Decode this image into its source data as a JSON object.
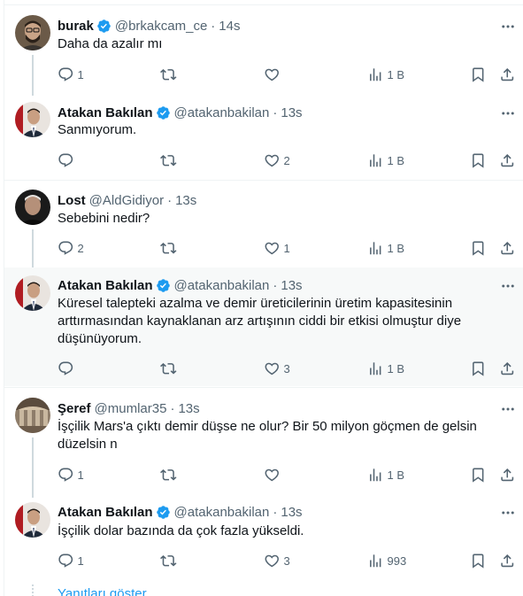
{
  "colors": {
    "verified": "#1d9bf0",
    "link": "#1d9bf0",
    "muted": "#536471",
    "highlight_bg": "#f7f9f9"
  },
  "tweets": [
    {
      "name": "burak",
      "handle": "@brkakcam_ce",
      "dot": "·",
      "time": "14s",
      "verified": true,
      "text": "Daha da azalır mı",
      "replies": "1",
      "retweets": "",
      "likes": "",
      "views": "1 B"
    },
    {
      "name": "Atakan Bakılan",
      "handle": "@atakanbakilan",
      "dot": "·",
      "time": "13s",
      "verified": true,
      "text": "Sanmıyorum.",
      "replies": "",
      "retweets": "",
      "likes": "2",
      "views": "1 B"
    },
    {
      "name": "Lost",
      "handle": "@AldGidiyor",
      "dot": "·",
      "time": "13s",
      "verified": false,
      "text": "Sebebini nedir?",
      "replies": "2",
      "retweets": "",
      "likes": "1",
      "views": "1 B"
    },
    {
      "name": "Atakan Bakılan",
      "handle": "@atakanbakilan",
      "dot": "·",
      "time": "13s",
      "verified": true,
      "text": "Küresel talepteki azalma ve demir üreticilerinin üretim kapasitesinin arttırmasından kaynaklanan arz artışının ciddi bir etkisi olmuştur diye düşünüyorum.",
      "replies": "",
      "retweets": "",
      "likes": "3",
      "views": "1 B"
    },
    {
      "name": "Şeref",
      "handle": "@mumlar35",
      "dot": "·",
      "time": "13s",
      "verified": false,
      "text": "İşçilik Mars'a çıktı demir düşse ne olur? Bir 50 milyon göçmen de gelsin düzelsin n",
      "replies": "1",
      "retweets": "",
      "likes": "",
      "views": "1 B"
    },
    {
      "name": "Atakan Bakılan",
      "handle": "@atakanbakilan",
      "dot": "·",
      "time": "13s",
      "verified": true,
      "text": "İşçilik dolar bazında da çok fazla yükseldi.",
      "replies": "1",
      "retweets": "",
      "likes": "3",
      "views": "993"
    }
  ],
  "show_replies": "Yanıtları göster",
  "icons": [
    "verified-badge-icon",
    "more-icon",
    "reply-icon",
    "retweet-icon",
    "like-icon",
    "views-icon",
    "bookmark-icon",
    "share-icon"
  ]
}
